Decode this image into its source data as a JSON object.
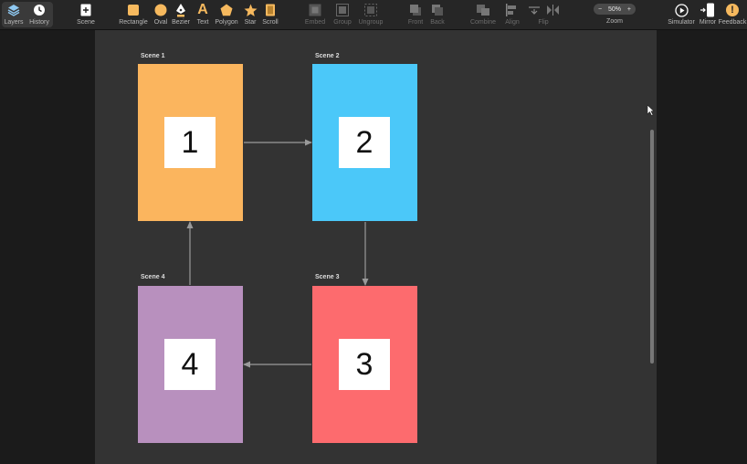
{
  "toolbar": {
    "layers": "Layers",
    "history": "History",
    "scene": "Scene",
    "rectangle": "Rectangle",
    "oval": "Oval",
    "bezier": "Bezier",
    "text": "Text",
    "text_glyph": "A",
    "polygon": "Polygon",
    "star": "Star",
    "scroll": "Scroll",
    "embed": "Embed",
    "group": "Group",
    "ungroup": "Ungroup",
    "front": "Front",
    "back": "Back",
    "combine": "Combine",
    "align": "Align",
    "flip": "Flip",
    "zoom_value": "50%",
    "zoom_minus": "−",
    "zoom_plus": "+",
    "zoom_label": "Zoom",
    "simulator": "Simulator",
    "mirror": "Mirror",
    "feedback": "Feedback",
    "feedback_glyph": "!"
  },
  "scenes": [
    {
      "title": "Scene 1",
      "number": "1",
      "color": "#FBB55E"
    },
    {
      "title": "Scene 2",
      "number": "2",
      "color": "#4BC8F9"
    },
    {
      "title": "Scene 3",
      "number": "3",
      "color": "#FD6B6E"
    },
    {
      "title": "Scene 4",
      "number": "4",
      "color": "#B890BE"
    }
  ],
  "colors": {
    "canvas": "#333333",
    "toolbar": "#262626",
    "accent_icon": "#F6B95E",
    "arrow": "#9a9a9a"
  }
}
